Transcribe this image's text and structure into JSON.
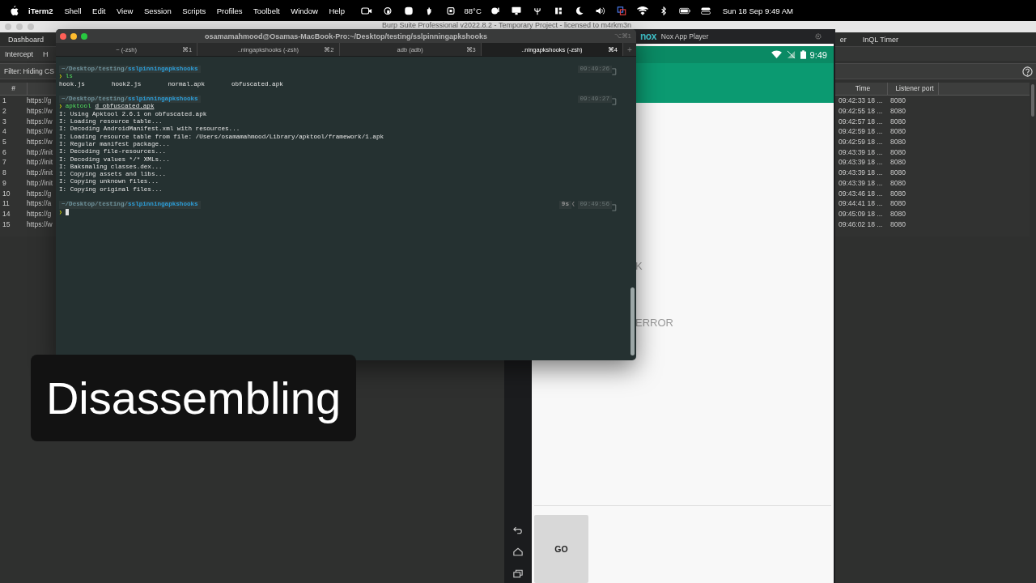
{
  "menu_bar": {
    "app": "iTerm2",
    "menus": [
      "Shell",
      "Edit",
      "View",
      "Session",
      "Scripts",
      "Profiles",
      "Toolbelt",
      "Window",
      "Help"
    ],
    "temperature": "88°C",
    "clock": "Sun 18 Sep  9:49 AM"
  },
  "burp": {
    "title": "Burp Suite Professional v2022.8.2 - Temporary Project - licensed to m4rkm3n",
    "tabs_row1": [
      {
        "label": "Dashboard",
        "selected": false
      }
    ],
    "tabs_row1_right": [
      {
        "label": "er",
        "selected": false
      },
      {
        "label": "InQL Timer",
        "selected": false
      }
    ],
    "tabs_row2": [
      {
        "label": "Intercept",
        "selected": false
      },
      {
        "label": "H",
        "selected": false
      }
    ],
    "filter": "Filter: Hiding CS",
    "left_columns": [
      "#"
    ],
    "right_columns": [
      "Time",
      "Listener port"
    ],
    "rows": [
      {
        "num": "1",
        "host": "https://g",
        "time": "09:42:33 18 ...",
        "port": "8080"
      },
      {
        "num": "2",
        "host": "https://w",
        "time": "09:42:55 18 ...",
        "port": "8080"
      },
      {
        "num": "3",
        "host": "https://w",
        "time": "09:42:57 18 ...",
        "port": "8080"
      },
      {
        "num": "4",
        "host": "https://w",
        "time": "09:42:59 18 ...",
        "port": "8080"
      },
      {
        "num": "5",
        "host": "https://w",
        "time": "09:42:59 18 ...",
        "port": "8080"
      },
      {
        "num": "6",
        "host": "http://init",
        "time": "09:43:39 18 ...",
        "port": "8080"
      },
      {
        "num": "7",
        "host": "http://init",
        "time": "09:43:39 18 ...",
        "port": "8080"
      },
      {
        "num": "8",
        "host": "http://init",
        "time": "09:43:39 18 ...",
        "port": "8080"
      },
      {
        "num": "9",
        "host": "http://init",
        "time": "09:43:39 18 ...",
        "port": "8080"
      },
      {
        "num": "10",
        "host": "https://g",
        "time": "09:43:46 18 ...",
        "port": "8080"
      },
      {
        "num": "11",
        "host": "https://a",
        "time": "09:44:41 18 ...",
        "port": "8080"
      },
      {
        "num": "14",
        "host": "https://g",
        "time": "09:45:09 18 ...",
        "port": "8080"
      },
      {
        "num": "15",
        "host": "https://w",
        "time": "09:46:02 18 ...",
        "port": "8080"
      }
    ]
  },
  "nox": {
    "logo": "nox",
    "title": "Nox App Player",
    "clock": "9:49",
    "labels": [
      "K",
      "ERROR"
    ],
    "button": "GO"
  },
  "terminal": {
    "title": "osamamahmood@Osamas-MacBook-Pro:~/Desktop/testing/sslpinningapkshooks",
    "shortcut": "⌥⌘1",
    "tabs": [
      {
        "label": "~ (-zsh)",
        "shortcut": "⌘1",
        "selected": false
      },
      {
        "label": "..ningapkshooks (-zsh)",
        "shortcut": "⌘2",
        "selected": false
      },
      {
        "label": "adb (adb)",
        "shortcut": "⌘3",
        "selected": false
      },
      {
        "label": "..ningapkshooks (-zsh)",
        "shortcut": "⌘4",
        "selected": true
      }
    ],
    "new_tab": "+",
    "blocks": [
      {
        "path_dim": "~/Desktop/testing/",
        "path_dir": "sslpinningapkshooks",
        "time": "09:49:26",
        "prompt": "❯",
        "program": "ls",
        "kind": "columns",
        "output": [
          "hook.js",
          "hook2.js",
          "normal.apk",
          "obfuscated.apk"
        ]
      },
      {
        "path_dim": "~/Desktop/testing/",
        "path_dir": "sslpinningapkshooks",
        "time": "09:49:27",
        "prompt": "❯",
        "program": "apktool",
        "args": "d obfuscated.apk",
        "kind": "lines",
        "output": [
          "I: Using Apktool 2.6.1 on obfuscated.apk",
          "I: Loading resource table...",
          "I: Decoding AndroidManifest.xml with resources...",
          "I: Loading resource table from file: /Users/osamamahmood/Library/apktool/framework/1.apk",
          "I: Regular manifest package...",
          "I: Decoding file-resources...",
          "I: Decoding values */* XMLs...",
          "I: Baksmaling classes.dex...",
          "I: Copying assets and libs...",
          "I: Copying unknown files...",
          "I: Copying original files..."
        ]
      },
      {
        "path_dim": "~/Desktop/testing/",
        "path_dir": "sslpinningapkshooks",
        "time": "09:49:56",
        "duration": "9s",
        "duration_sep": "❮",
        "prompt": "❯",
        "cursor": true
      }
    ]
  },
  "caption": "Disassembling"
}
